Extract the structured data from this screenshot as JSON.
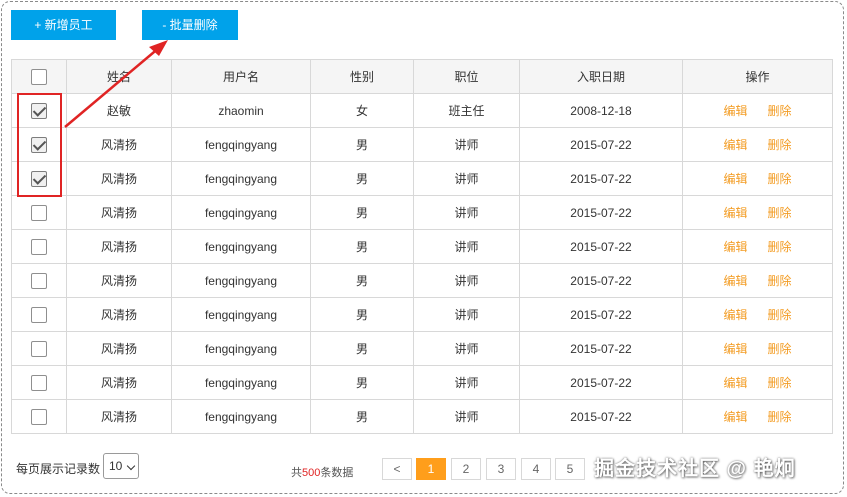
{
  "toolbar": {
    "add_label": "+ 新增员工",
    "batch_delete_label": "- 批量删除"
  },
  "table": {
    "headers": [
      "姓名",
      "用户名",
      "性别",
      "职位",
      "入职日期",
      "操作"
    ],
    "rows": [
      {
        "checked": true,
        "name": "赵敏",
        "username": "zhaomin",
        "gender": "女",
        "position": "班主任",
        "date": "2008-12-18"
      },
      {
        "checked": true,
        "name": "风清扬",
        "username": "fengqingyang",
        "gender": "男",
        "position": "讲师",
        "date": "2015-07-22"
      },
      {
        "checked": true,
        "name": "风清扬",
        "username": "fengqingyang",
        "gender": "男",
        "position": "讲师",
        "date": "2015-07-22"
      },
      {
        "checked": false,
        "name": "风清扬",
        "username": "fengqingyang",
        "gender": "男",
        "position": "讲师",
        "date": "2015-07-22"
      },
      {
        "checked": false,
        "name": "风清扬",
        "username": "fengqingyang",
        "gender": "男",
        "position": "讲师",
        "date": "2015-07-22"
      },
      {
        "checked": false,
        "name": "风清扬",
        "username": "fengqingyang",
        "gender": "男",
        "position": "讲师",
        "date": "2015-07-22"
      },
      {
        "checked": false,
        "name": "风清扬",
        "username": "fengqingyang",
        "gender": "男",
        "position": "讲师",
        "date": "2015-07-22"
      },
      {
        "checked": false,
        "name": "风清扬",
        "username": "fengqingyang",
        "gender": "男",
        "position": "讲师",
        "date": "2015-07-22"
      },
      {
        "checked": false,
        "name": "风清扬",
        "username": "fengqingyang",
        "gender": "男",
        "position": "讲师",
        "date": "2015-07-22"
      },
      {
        "checked": false,
        "name": "风清扬",
        "username": "fengqingyang",
        "gender": "男",
        "position": "讲师",
        "date": "2015-07-22"
      }
    ],
    "actions": {
      "edit": "编辑",
      "delete": "删除"
    }
  },
  "footer": {
    "page_size_label": "每页展示记录数",
    "page_size_value": "10",
    "total_prefix": "共",
    "total_count": "500",
    "total_suffix": "条数据"
  },
  "pagination": {
    "prev": "<",
    "pages": [
      "1",
      "2",
      "3",
      "4",
      "5"
    ],
    "current": "1"
  },
  "watermark": "掘金技术社区 @ 艳炯",
  "colors": {
    "primary": "#00a2ea",
    "action": "#f39c23",
    "annotation": "#e02424",
    "active_page": "#ff9e1b"
  },
  "icons": [
    "checkbox-icon",
    "arrow-annotation",
    "dropdown-caret-icon"
  ]
}
